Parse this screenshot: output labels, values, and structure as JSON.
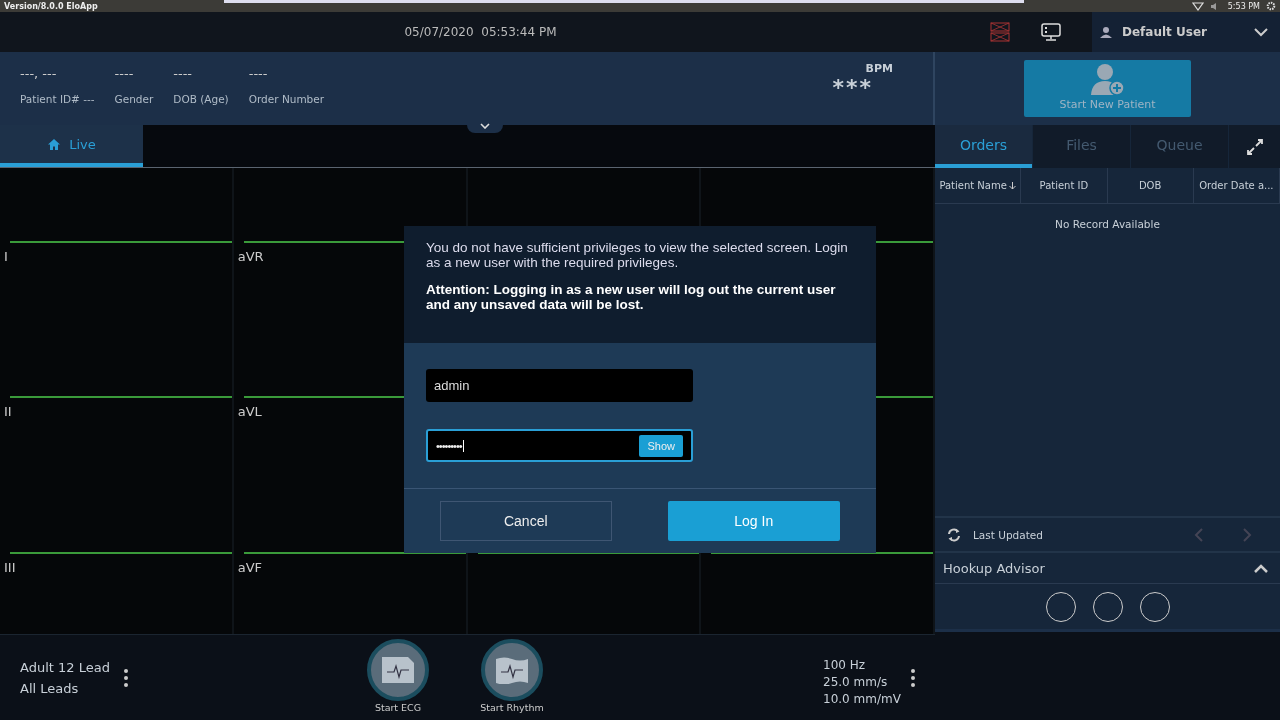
{
  "os_bar": {
    "title": "Version/8.0.0 EloApp",
    "clock": "5:53 PM"
  },
  "header": {
    "date": "05/07/2020",
    "time": "05:53:44 PM",
    "user": "Default User"
  },
  "patient": {
    "fields": [
      {
        "value": "---, ---",
        "label": "Patient ID# ---"
      },
      {
        "value": "----",
        "label": "Gender"
      },
      {
        "value": "----",
        "label": "DOB (Age)"
      },
      {
        "value": "----",
        "label": "Order Number"
      }
    ],
    "heart_rate": {
      "value": "***",
      "unit": "BPM"
    },
    "new_patient_button": "Start New Patient"
  },
  "view_tabs": [
    {
      "label": "Live",
      "selected": true
    }
  ],
  "lead_rows": [
    [
      "I",
      "aVR"
    ],
    [
      "II",
      "aVL"
    ],
    [
      "III",
      "aVF"
    ]
  ],
  "side_panel": {
    "tabs": [
      {
        "label": "Orders",
        "selected": true
      },
      {
        "label": "Files",
        "selected": false
      },
      {
        "label": "Queue",
        "selected": false
      }
    ],
    "columns": [
      {
        "label": "Patient Name",
        "sorted": true
      },
      {
        "label": "Patient ID",
        "sorted": false
      },
      {
        "label": "DOB",
        "sorted": false
      },
      {
        "label": "Order Date a...",
        "sorted": false
      }
    ],
    "empty_text": "No Record Available",
    "last_updated": "Last Updated",
    "hookup": {
      "title": "Hookup Advisor",
      "expanded": true
    }
  },
  "dialog": {
    "message": "You do not have sufficient privileges to view the selected screen. Login as a new user with the required privileges.",
    "warning": "Attention: Logging in as a new user will log out the current user and any unsaved data will be lost.",
    "username": "admin",
    "password": "•••••••••",
    "show_button": "Show",
    "cancel": "Cancel",
    "login": "Log In"
  },
  "bottom": {
    "protocol": "Adult 12 Lead",
    "leads": "All Leads",
    "actions": [
      {
        "label": "Start ECG",
        "kind": "ecg"
      },
      {
        "label": "Start Rhythm",
        "kind": "rhythm"
      }
    ],
    "settings": [
      "100 Hz",
      "25.0 mm/s",
      "10.0 mm/mV"
    ]
  }
}
